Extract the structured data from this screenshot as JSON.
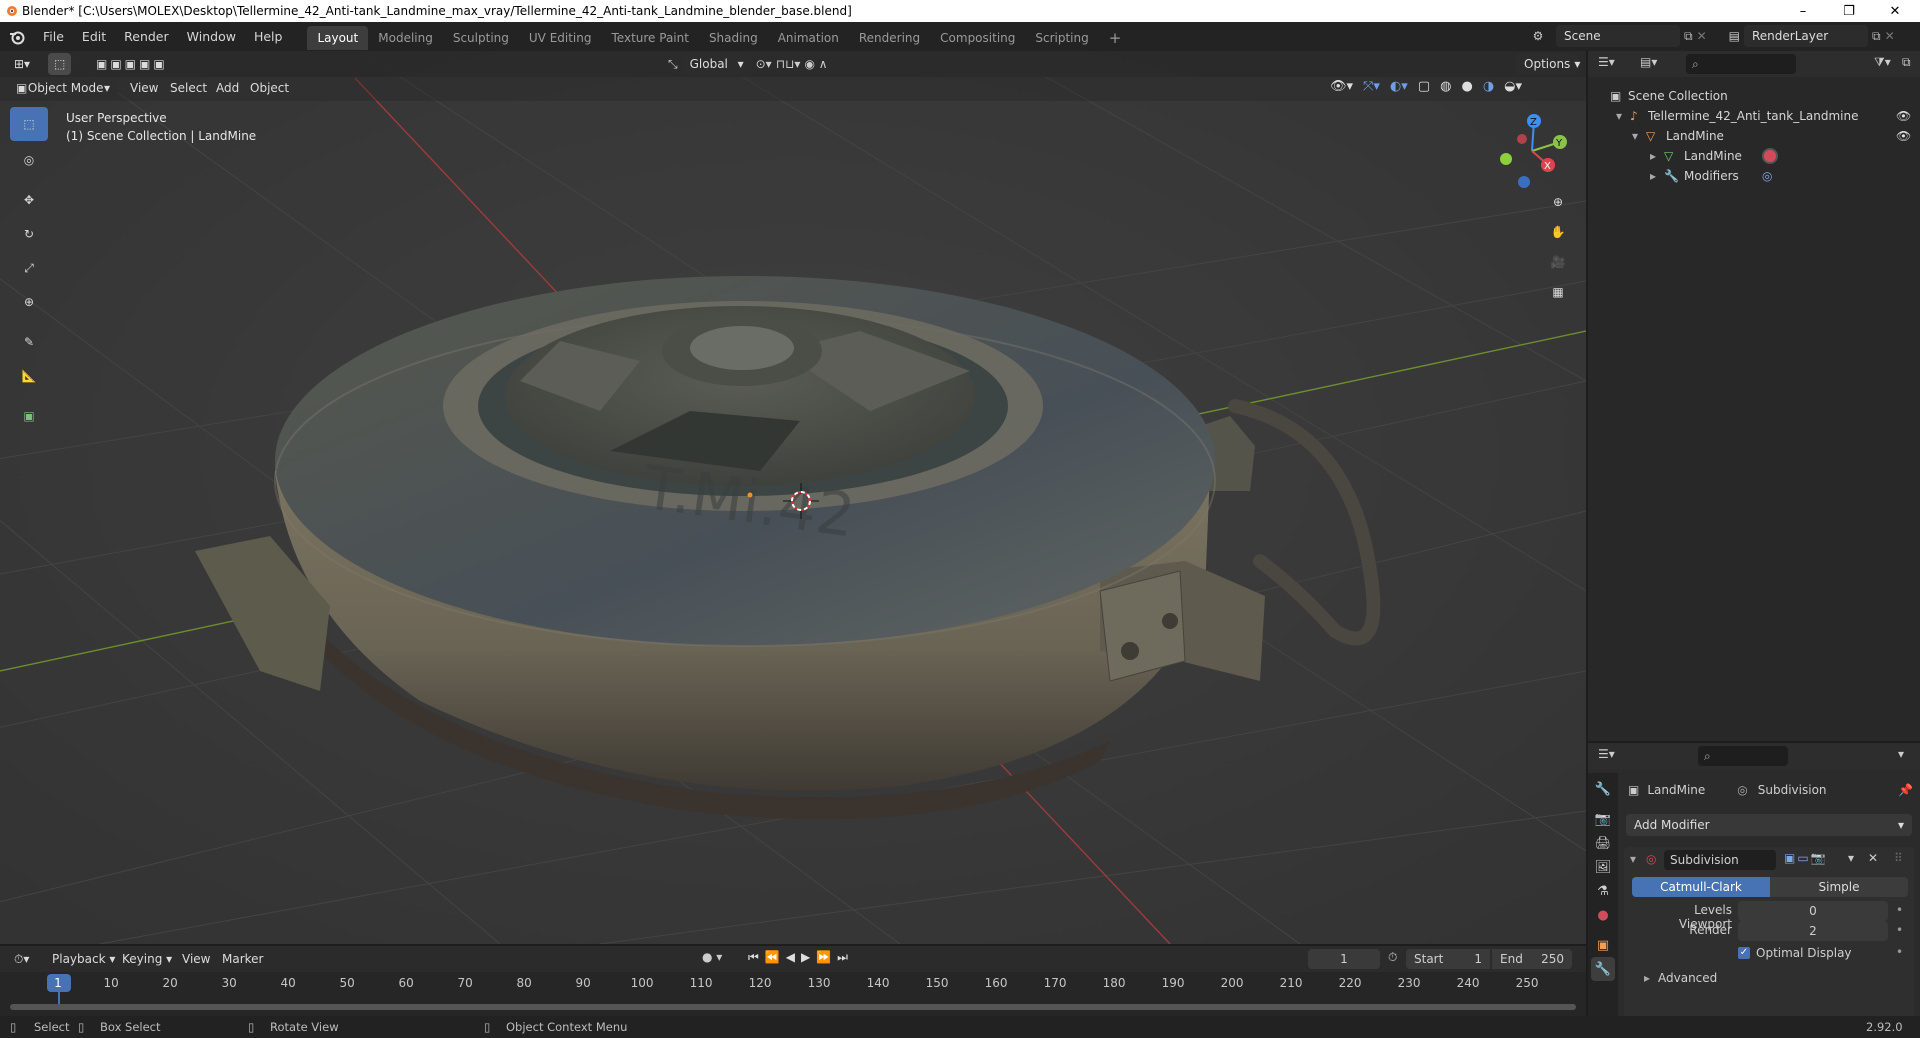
{
  "window": {
    "title": "Blender* [C:\\Users\\MOLEX\\Desktop\\Tellermine_42_Anti-tank_Landmine_max_vray/Tellermine_42_Anti-tank_Landmine_blender_base.blend]",
    "minimize": "–",
    "restore": "❐",
    "close": "✕"
  },
  "menu": [
    "File",
    "Edit",
    "Render",
    "Window",
    "Help"
  ],
  "workspaces": [
    "Layout",
    "Modeling",
    "Sculpting",
    "UV Editing",
    "Texture Paint",
    "Shading",
    "Animation",
    "Rendering",
    "Compositing",
    "Scripting"
  ],
  "active_workspace": "Layout",
  "add_workspace": "+",
  "scene": {
    "name": "Scene",
    "render_layer": "RenderLayer"
  },
  "viewport": {
    "mode": "Object Mode",
    "menus": [
      "View",
      "Select",
      "Add",
      "Object"
    ],
    "transform_orientation": "Global",
    "options": "Options",
    "overlay_title": "User Perspective",
    "overlay_sub": "(1) Scene Collection | LandMine",
    "gizmo": {
      "x": "X",
      "y": "Y",
      "z": "Z"
    }
  },
  "outliner": {
    "rows": [
      {
        "label": "Scene Collection",
        "icon": "scene-collection-icon"
      },
      {
        "label": "Tellermine_42_Anti_tank_Landmine",
        "icon": "armature-icon"
      },
      {
        "label": "LandMine",
        "icon": "object-icon"
      },
      {
        "label": "LandMine",
        "icon": "mesh-icon"
      },
      {
        "label": "Modifiers",
        "icon": "wrench-icon"
      }
    ]
  },
  "properties": {
    "object": "LandMine",
    "modifier_tab": "Subdivision",
    "add_modifier": "Add Modifier",
    "modifier_name": "Subdivision",
    "mode_a": "Catmull-Clark",
    "mode_b": "Simple",
    "levels_label": "Levels Viewport",
    "levels_value": "0",
    "render_label": "Render",
    "render_value": "2",
    "optimal_label": "Optimal Display",
    "advanced_label": "Advanced"
  },
  "timeline": {
    "menus": [
      "Playback",
      "Keying",
      "View",
      "Marker"
    ],
    "current_frame": "1",
    "start_label": "Start",
    "start": "1",
    "end_label": "End",
    "end": "250",
    "ticks": [
      "1",
      "10",
      "20",
      "30",
      "40",
      "50",
      "60",
      "70",
      "80",
      "90",
      "100",
      "110",
      "120",
      "130",
      "140",
      "150",
      "160",
      "170",
      "180",
      "190",
      "200",
      "210",
      "220",
      "230",
      "240",
      "250"
    ]
  },
  "status": {
    "select": "Select",
    "box_select": "Box Select",
    "rotate": "Rotate View",
    "context": "Object Context Menu",
    "version": "2.92.0"
  },
  "colors": {
    "accent": "#4772b3",
    "x_axis": "#e0434d",
    "y_axis": "#8bc34a",
    "z_axis": "#3e8ff5"
  }
}
